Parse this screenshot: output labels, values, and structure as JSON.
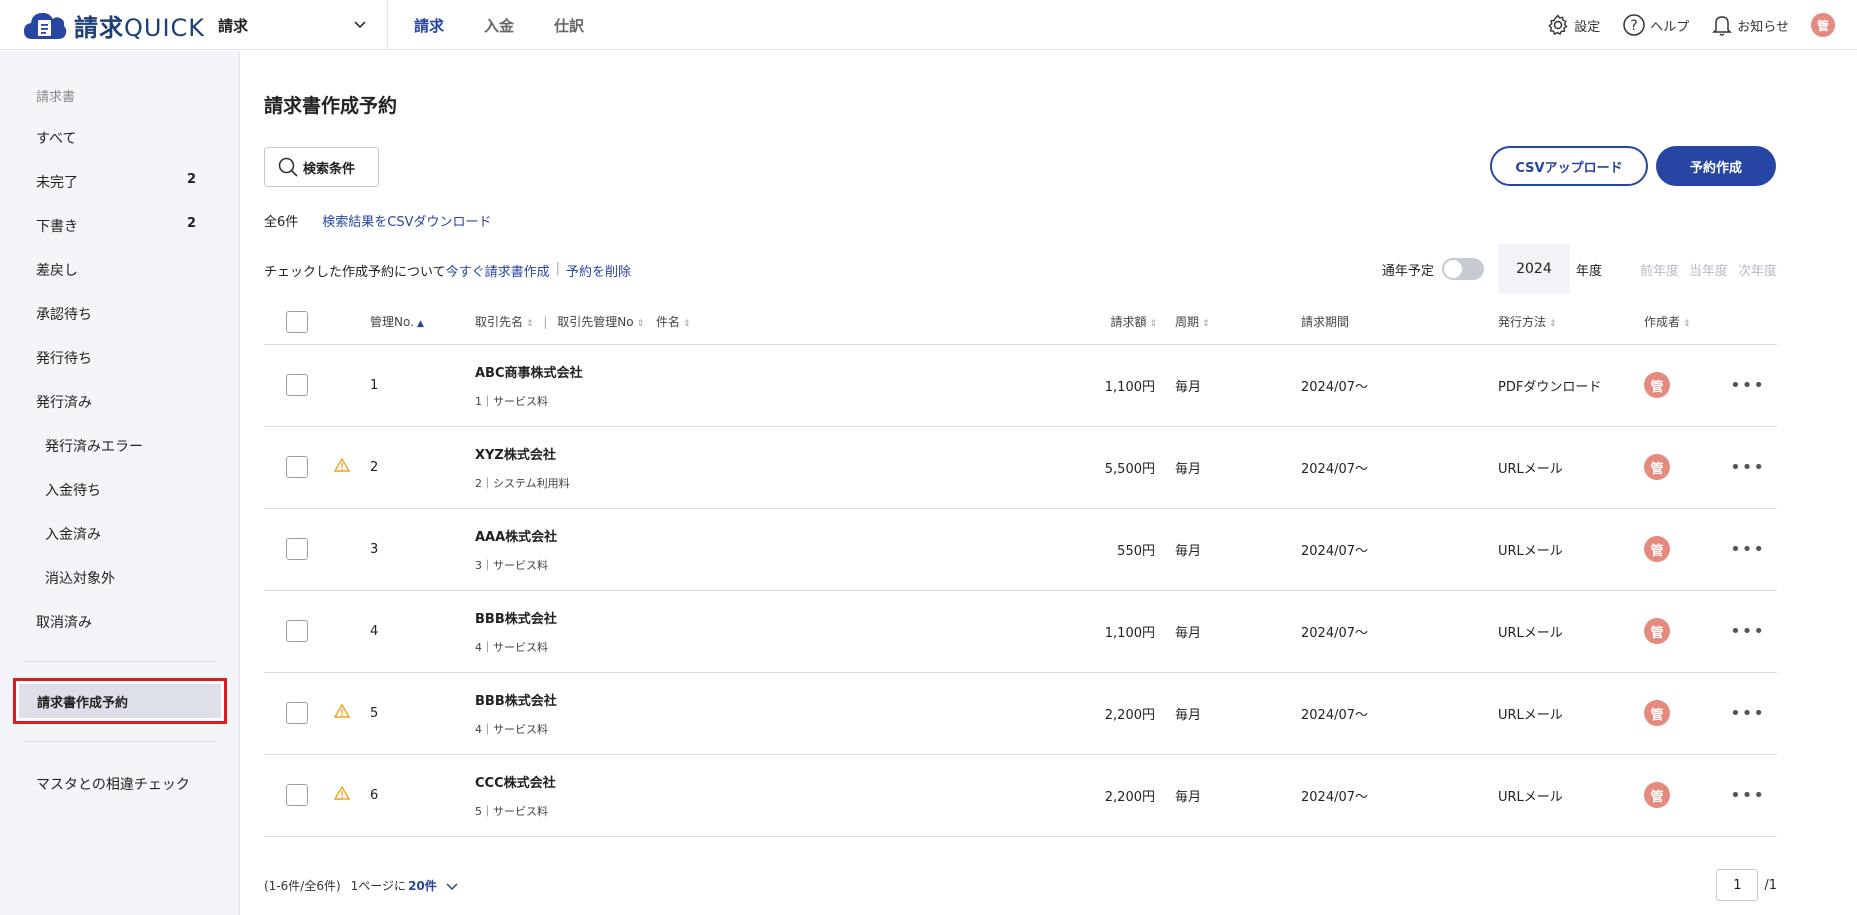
{
  "header": {
    "logo_text_bold": "請求",
    "logo_text_rest": "QUICK",
    "app_select": "請求",
    "nav": [
      "請求",
      "入金",
      "仕訳"
    ],
    "settings": "設定",
    "help": "ヘルプ",
    "notice": "お知らせ",
    "avatar": "管"
  },
  "sidebar": {
    "section": "請求書",
    "items": [
      {
        "label": "すべて",
        "count": ""
      },
      {
        "label": "未完了",
        "count": "2"
      },
      {
        "label": "下書き",
        "count": "2"
      },
      {
        "label": "差戻し",
        "count": ""
      },
      {
        "label": "承認待ち",
        "count": ""
      },
      {
        "label": "発行待ち",
        "count": ""
      },
      {
        "label": "発行済み",
        "count": ""
      },
      {
        "label": "発行済みエラー",
        "count": ""
      },
      {
        "label": "入金待ち",
        "count": ""
      },
      {
        "label": "入金済み",
        "count": ""
      },
      {
        "label": "消込対象外",
        "count": ""
      },
      {
        "label": "取消済み",
        "count": ""
      }
    ],
    "active": "請求書作成予約",
    "check": "マスタとの相違チェック"
  },
  "main": {
    "title": "請求書作成予約",
    "search_btn": "検索条件",
    "csv_upload": "CSVアップロード",
    "create": "予約作成",
    "total": "全6件",
    "csv_download": "検索結果をCSVダウンロード",
    "action_label": "チェックした作成予約について",
    "action_now": "今すぐ請求書作成",
    "action_delete": "予約を削除",
    "yearly": "通年予定",
    "year": "2024",
    "nendo": "年度",
    "prev_year": "前年度",
    "this_year": "当年度",
    "next_year": "次年度"
  },
  "table": {
    "headers": {
      "no": "管理No.",
      "client": "取引先名",
      "client_no": "取引先管理No",
      "subject": "件名",
      "amount": "請求額",
      "cycle": "周期",
      "period": "請求期間",
      "method": "発行方法",
      "creator": "作成者"
    },
    "rows": [
      {
        "warn": false,
        "no": "1",
        "client": "ABC商事株式会社",
        "sub": "1｜サービス料",
        "amount": "1,100円",
        "cycle": "毎月",
        "period": "2024/07～",
        "method": "PDFダウンロード",
        "creator": "管"
      },
      {
        "warn": true,
        "no": "2",
        "client": "XYZ株式会社",
        "sub": "2｜システム利用料",
        "amount": "5,500円",
        "cycle": "毎月",
        "period": "2024/07～",
        "method": "URLメール",
        "creator": "管"
      },
      {
        "warn": false,
        "no": "3",
        "client": "AAA株式会社",
        "sub": "3｜サービス料",
        "amount": "550円",
        "cycle": "毎月",
        "period": "2024/07～",
        "method": "URLメール",
        "creator": "管"
      },
      {
        "warn": false,
        "no": "4",
        "client": "BBB株式会社",
        "sub": "4｜サービス料",
        "amount": "1,100円",
        "cycle": "毎月",
        "period": "2024/07～",
        "method": "URLメール",
        "creator": "管"
      },
      {
        "warn": true,
        "no": "5",
        "client": "BBB株式会社",
        "sub": "4｜サービス料",
        "amount": "2,200円",
        "cycle": "毎月",
        "period": "2024/07～",
        "method": "URLメール",
        "creator": "管"
      },
      {
        "warn": true,
        "no": "6",
        "client": "CCC株式会社",
        "sub": "5｜サービス料",
        "amount": "2,200円",
        "cycle": "毎月",
        "period": "2024/07～",
        "method": "URLメール",
        "creator": "管"
      }
    ]
  },
  "pager": {
    "range": "(1-6件/全6件)",
    "per_page_label": "1ページに",
    "per_page": "20件",
    "page": "1",
    "total_pages": "/1"
  },
  "colors": {
    "accent": "#2745a2",
    "highlight": "#e21b22",
    "avatar": "#e58a7e",
    "warning": "#f0a020"
  }
}
